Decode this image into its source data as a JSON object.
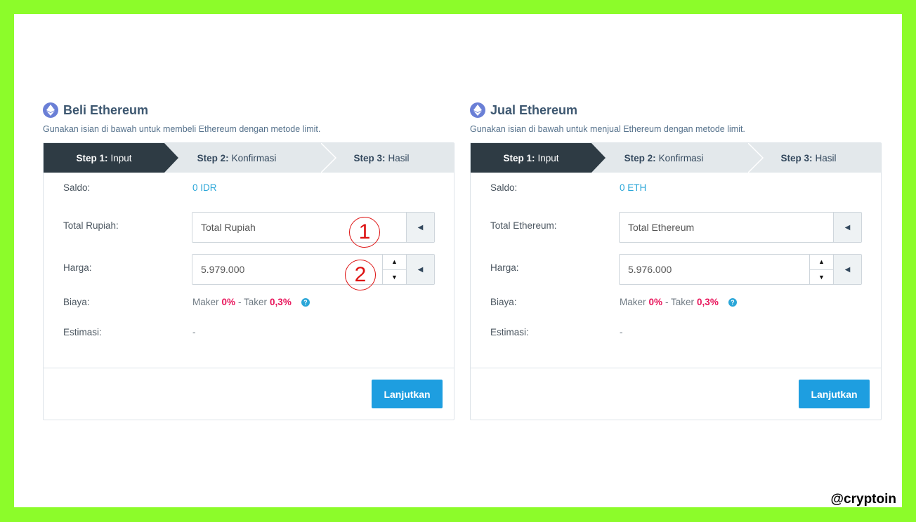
{
  "buy": {
    "title": "Beli Ethereum",
    "subtitle": "Gunakan isian di bawah untuk membeli Ethereum dengan metode limit.",
    "steps": [
      {
        "bold": "Step 1:",
        "text": "Input"
      },
      {
        "bold": "Step 2:",
        "text": "Konfirmasi"
      },
      {
        "bold": "Step 3:",
        "text": "Hasil"
      }
    ],
    "saldo_label": "Saldo:",
    "saldo_value": "0 IDR",
    "total_label": "Total Rupiah:",
    "total_placeholder": "Total Rupiah",
    "harga_label": "Harga:",
    "harga_value": "5.979.000",
    "biaya_label": "Biaya:",
    "maker_label": "Maker",
    "maker_value": "0%",
    "taker_label": "- Taker",
    "taker_value": "0,3%",
    "estimasi_label": "Estimasi:",
    "estimasi_value": "-",
    "button": "Lanjutkan"
  },
  "sell": {
    "title": "Jual Ethereum",
    "subtitle": "Gunakan isian di bawah untuk menjual Ethereum dengan metode limit.",
    "steps": [
      {
        "bold": "Step 1:",
        "text": "Input"
      },
      {
        "bold": "Step 2:",
        "text": "Konfirmasi"
      },
      {
        "bold": "Step 3:",
        "text": "Hasil"
      }
    ],
    "saldo_label": "Saldo:",
    "saldo_value": "0 ETH",
    "total_label": "Total Ethereum:",
    "total_placeholder": "Total Ethereum",
    "harga_label": "Harga:",
    "harga_value": "5.976.000",
    "biaya_label": "Biaya:",
    "maker_label": "Maker",
    "maker_value": "0%",
    "taker_label": "- Taker",
    "taker_value": "0,3%",
    "estimasi_label": "Estimasi:",
    "estimasi_value": "-",
    "button": "Lanjutkan"
  },
  "annotations": [
    "1",
    "2"
  ],
  "watermark": "@cryptoin",
  "colors": {
    "frame": "#8cfc2a",
    "active_step": "#2e3b44",
    "button": "#1e9ee0",
    "accent": "#2aa6d8",
    "fee_highlight": "#e8155b",
    "annotation": "#dd1111"
  },
  "icons": {
    "title_icon": "ethereum-icon",
    "addon": "caret-left-icon",
    "spin_up": "caret-up-icon",
    "spin_down": "caret-down-icon",
    "help": "question-circle-icon"
  }
}
